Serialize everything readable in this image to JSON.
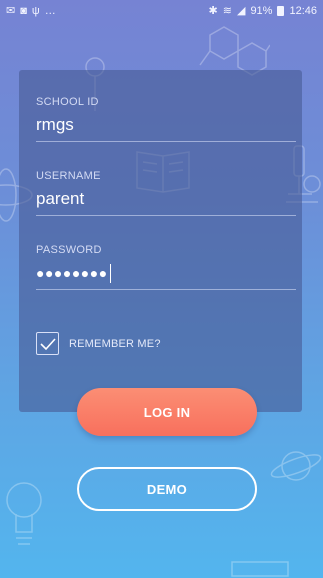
{
  "status_bar": {
    "battery_text": "91%",
    "time": "12:46",
    "icons_left": [
      "mail-icon",
      "notification-icon",
      "usb-icon",
      "more-icon"
    ],
    "icons_right": [
      "bluetooth-icon",
      "wifi-icon",
      "signal-icon",
      "battery-icon"
    ]
  },
  "login_form": {
    "school_id": {
      "label": "SCHOOL ID",
      "value": "rmgs"
    },
    "username": {
      "label": "USERNAME",
      "value": "parent"
    },
    "password": {
      "label": "PASSWORD",
      "masked_value": "●●●●●●●●"
    },
    "remember_me": {
      "label": "REMEMBER ME?",
      "checked": true
    }
  },
  "buttons": {
    "login_label": "LOG IN",
    "demo_label": "DEMO"
  },
  "colors": {
    "background_top": "#7683d3",
    "background_bottom": "#53b5ee",
    "card": "#485c96",
    "login_button": "#f8705d"
  }
}
